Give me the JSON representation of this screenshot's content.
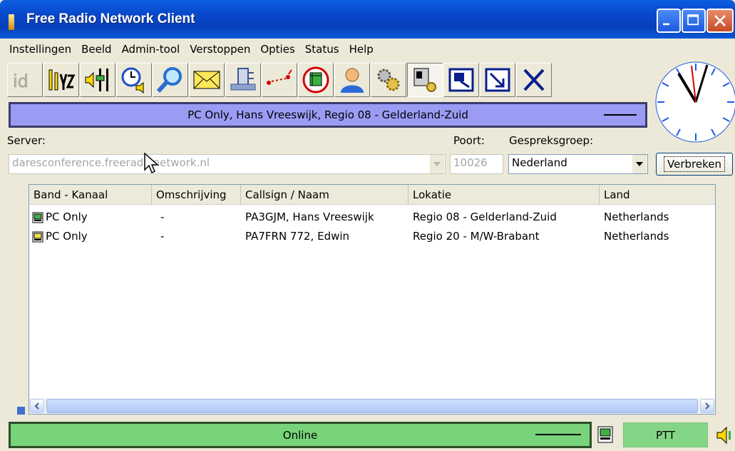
{
  "window": {
    "title": "Free Radio Network Client"
  },
  "menu": [
    "Instellingen",
    "Beeld",
    "Admin-tool",
    "Verstoppen",
    "Opties",
    "Status",
    "Help"
  ],
  "toolbar": {
    "icons": [
      "id-icon",
      "people-icon",
      "volume-slider-icon",
      "timer-icon",
      "search-icon",
      "mail-icon",
      "plug-icon",
      "connection-icon",
      "pc-only-icon",
      "user-icon",
      "gears-icon",
      "settings-pc-icon",
      "window-icon",
      "minimize-icon",
      "exit-icon"
    ]
  },
  "banner": {
    "text": "PC Only, Hans Vreeswijk, Regio 08 - Gelderland-Zuid"
  },
  "form": {
    "server_label": "Server:",
    "port_label": "Poort:",
    "group_label": "Gespreksgroep:",
    "server_value": "daresconference.freeradionetwork.nl",
    "port_value": "10026",
    "group_value": "Nederland",
    "disconnect_label": "Verbreken"
  },
  "table": {
    "columns": [
      "Band - Kanaal",
      "Omschrijving",
      "Callsign / Naam",
      "Lokatie",
      "Land"
    ],
    "rows": [
      {
        "band": "PC Only",
        "desc": "-",
        "callsign": "PA3GJM, Hans Vreeswijk",
        "location": "Regio 08 - Gelderland-Zuid",
        "country": "Netherlands"
      },
      {
        "band": "PC Only",
        "desc": "-",
        "callsign": "PA7FRN 772, Edwin",
        "location": "Regio 20 - M/W-Brabant",
        "country": "Netherlands"
      }
    ]
  },
  "status": {
    "text": "Online",
    "ptt_label": "PTT"
  },
  "colors": {
    "banner": "#9a9cf4",
    "status": "#77d47a",
    "titlebar": "#0846c9"
  }
}
